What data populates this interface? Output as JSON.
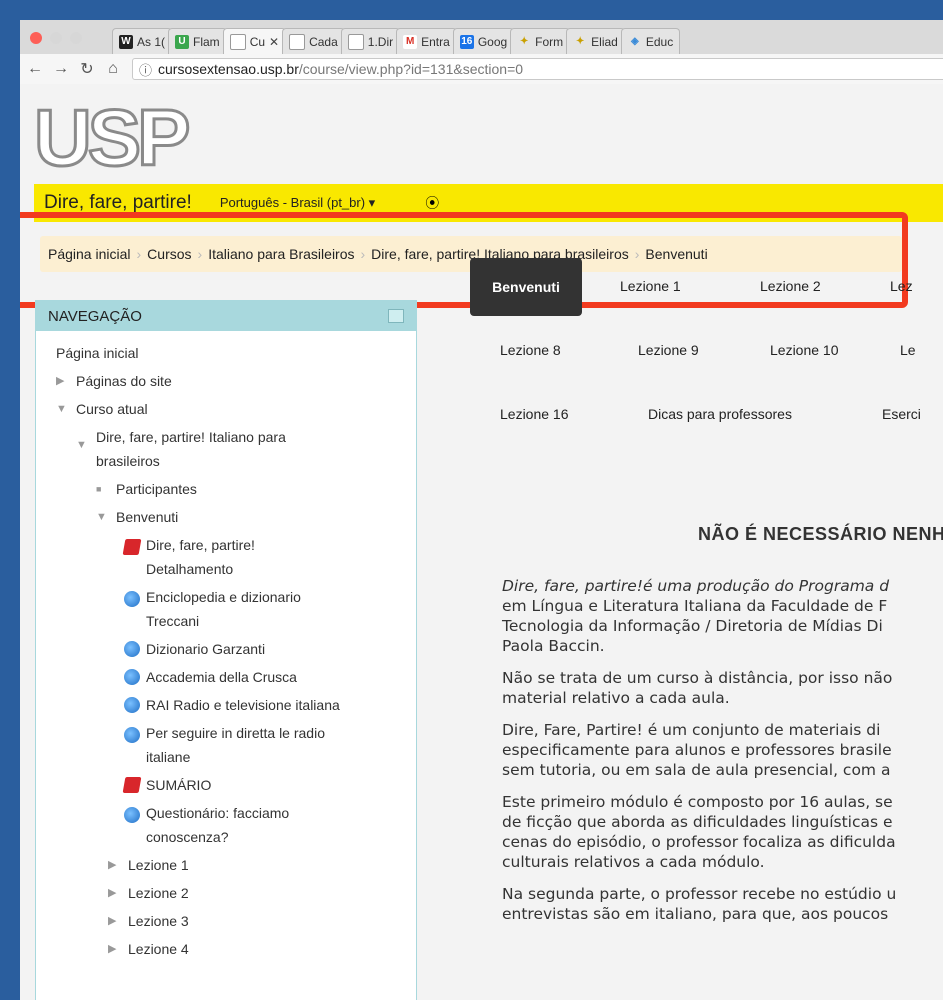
{
  "browser": {
    "tabs": [
      {
        "label": "As 1(",
        "icon": "W"
      },
      {
        "label": "Flam",
        "icon": "U"
      },
      {
        "label": "Cu",
        "icon": "doc",
        "active": true
      },
      {
        "label": "Cada",
        "icon": "doc"
      },
      {
        "label": "1.Dir",
        "icon": "doc"
      },
      {
        "label": "Entra",
        "icon": "M"
      },
      {
        "label": "Goog",
        "icon": "16"
      },
      {
        "label": "Form",
        "icon": "star"
      },
      {
        "label": "Eliad",
        "icon": "star"
      },
      {
        "label": "Educ",
        "icon": "cube"
      }
    ],
    "url_host": "cursosextensao.usp.br",
    "url_path": "/course/view.php?id=131&section=0"
  },
  "site": {
    "logo": "USP",
    "name": "Dire, fare, partire!",
    "language": "Português - Brasil (pt_br) ▾",
    "login_icon": "⦿"
  },
  "breadcrumb": [
    "Página inicial",
    "Cursos",
    "Italiano para Brasileiros",
    "Dire, fare, partire! Italiano para brasileiros",
    "Benvenuti"
  ],
  "nav": {
    "title": "NAVEGAÇÃO",
    "home": "Página inicial",
    "site_pages": "Páginas do site",
    "current_course": "Curso atual",
    "course_name_1": "Dire, fare, partire! Italiano para",
    "course_name_2": "brasileiros",
    "participants": "Participantes",
    "benvenuti": "Benvenuti",
    "items": [
      {
        "l1": "Dire, fare, partire!",
        "l2": "Detalhamento",
        "type": "pdf"
      },
      {
        "l1": "Enciclopedia e dizionario",
        "l2": "Treccani",
        "type": "url"
      },
      {
        "l1": "Dizionario Garzanti",
        "type": "url"
      },
      {
        "l1": "Accademia della Crusca",
        "type": "url"
      },
      {
        "l1": "RAI Radio e televisione italiana",
        "type": "url"
      },
      {
        "l1": "Per seguire in diretta le radio",
        "l2": "italiane",
        "type": "url"
      },
      {
        "l1": "SUMÁRIO",
        "type": "pdf"
      },
      {
        "l1": "Questionário: facciamo",
        "l2": "conoscenza?",
        "type": "url"
      }
    ],
    "lessons": [
      "Lezione 1",
      "Lezione 2",
      "Lezione 3",
      "Lezione 4"
    ]
  },
  "course_tabs": {
    "row1": [
      "Benvenuti",
      "Lezione 1",
      "Lezione 2",
      "Lez"
    ],
    "row2": [
      "Lezione 8",
      "Lezione 9",
      "Lezione 10",
      "Le"
    ],
    "row3": [
      "Lezione 16",
      "Dicas para professores",
      "Eserci"
    ]
  },
  "content": {
    "heading": "NÃO É NECESSÁRIO NENH",
    "p1": [
      "Dire, fare, partire!é uma produção do Programa d",
      "em Língua e Literatura Italiana da Faculdade de F",
      "Tecnologia da Informação / Diretoria de Mídias Di",
      "Paola Baccin."
    ],
    "p2": [
      "Não se trata de um curso à distância, por isso não",
      "material relativo a cada aula."
    ],
    "p3": [
      "Dire, Fare, Partire! é um conjunto de materiais di",
      "especificamente para alunos e professores brasile",
      "sem tutoria, ou em sala de aula presencial, com a"
    ],
    "p4": [
      "Este primeiro módulo é composto por 16 aulas, se",
      "de ficção que aborda as dificuldades linguísticas e",
      "cenas do episódio, o professor focaliza as dificulda",
      "culturais relativos a cada módulo."
    ],
    "p5": [
      "Na segunda parte, o professor recebe no estúdio u",
      "entrevistas são em italiano, para que, aos poucos"
    ]
  }
}
